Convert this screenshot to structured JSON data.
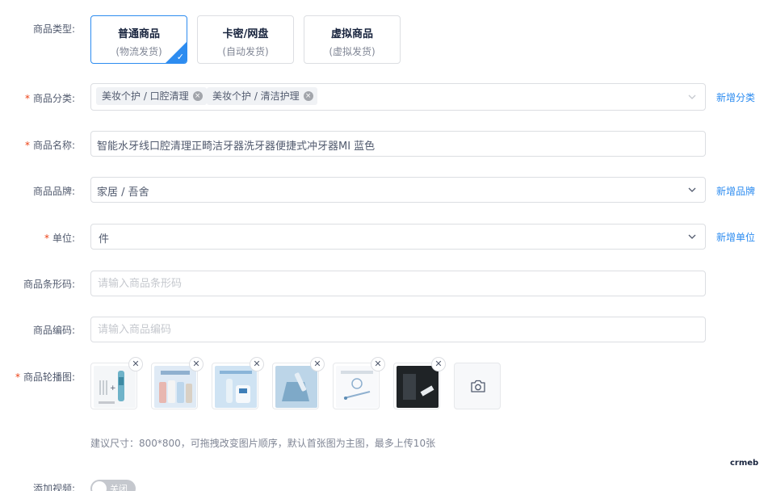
{
  "form": {
    "product_type": {
      "label": "商品类型:",
      "options": [
        {
          "title": "普通商品",
          "sub": "(物流发货)",
          "selected": true
        },
        {
          "title": "卡密/网盘",
          "sub": "(自动发货)",
          "selected": false
        },
        {
          "title": "虚拟商品",
          "sub": "(虚拟发货)",
          "selected": false
        }
      ]
    },
    "category": {
      "required": "*",
      "label": "商品分类:",
      "tags": [
        "美妆个护 / 口腔清理",
        "美妆个护 / 清洁护理"
      ],
      "add_link": "新增分类"
    },
    "name": {
      "required": "*",
      "label": "商品名称:",
      "value": "智能水牙线口腔清理正畸洁牙器洗牙器便捷式冲牙器MI 蓝色"
    },
    "brand": {
      "label": "商品品牌:",
      "value": "家居 / 吾舍",
      "add_link": "新增品牌"
    },
    "unit": {
      "required": "*",
      "label": "单位:",
      "value": "件",
      "add_link": "新增单位"
    },
    "barcode": {
      "label": "商品条形码:",
      "placeholder": "请输入商品条形码"
    },
    "code": {
      "label": "商品编码:",
      "placeholder": "请输入商品编码"
    },
    "carousel": {
      "required": "*",
      "label": "商品轮播图:",
      "image_count": 6,
      "hint": "建议尺寸：800*800，可拖拽改变图片顺序，默认首张图为主图，最多上传10张",
      "delete_glyph": "✕"
    },
    "video": {
      "label": "添加视频:",
      "switch_text": "关闭",
      "enabled": false
    }
  },
  "watermark": "crmeb",
  "colors": {
    "primary": "#2d8cf0",
    "required": "#ed4014",
    "border": "#dcdee2",
    "placeholder": "#c5c8ce"
  },
  "icons": {
    "selected_check": "✓",
    "tag_close": "×",
    "upload": "camera-icon",
    "dropdown": "chevron-down-icon"
  }
}
